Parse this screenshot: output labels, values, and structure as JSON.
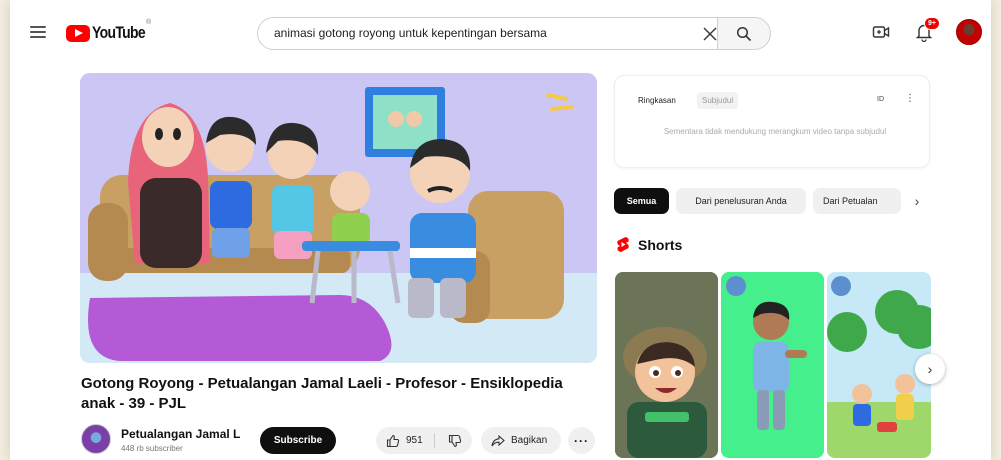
{
  "header": {
    "logo_text": "YouTube",
    "region_code": "ID",
    "search": {
      "value": "animasi gotong royong untuk kepentingan bersama"
    },
    "notifications_badge": "9+"
  },
  "video": {
    "title": "Gotong Royong - Petualangan Jamal Laeli - Profesor - Ensiklopedia anak - 39 - PJL",
    "channel": {
      "name": "Petualangan Jamal L",
      "subscribers": "448 rb subscriber",
      "subscribe_label": "Subscribe"
    },
    "actions": {
      "like_count": "951",
      "share_label": "Bagikan",
      "more_label": "···"
    }
  },
  "summary": {
    "tab_active": "Ringkasan",
    "tab_inactive": "Subjudul",
    "lang": "ID",
    "message": "Sementara tidak mendukung merangkum video tanpa subjudul"
  },
  "chips": [
    {
      "label": "Semua"
    },
    {
      "label": "Dari penelusuran Anda"
    },
    {
      "label": "Dari Petualan"
    }
  ],
  "shorts": {
    "label": "Shorts"
  },
  "colors": {
    "brand_red": "#ff0000",
    "chip_active": "#0f0f0f",
    "chip_bg": "#f0f0f0"
  }
}
